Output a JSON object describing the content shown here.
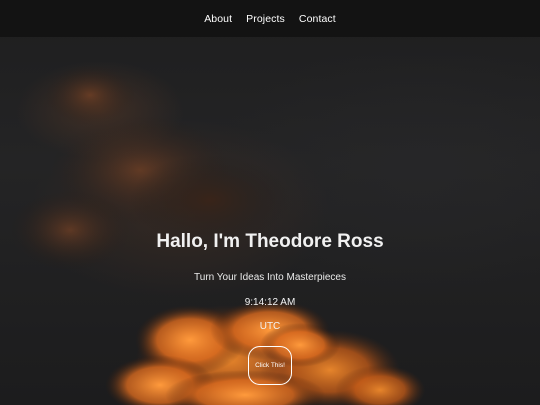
{
  "nav": {
    "items": [
      {
        "label": "About"
      },
      {
        "label": "Projects"
      },
      {
        "label": "Contact"
      }
    ]
  },
  "hero": {
    "title": "Hallo, I'm Theodore Ross",
    "subtitle": "Turn Your Ideas Into Masterpieces",
    "time": "9:14:12 AM",
    "timezone": "UTC",
    "button_label": "Click This!"
  },
  "colors": {
    "navbar_bg": "#131313",
    "sky_dark": "#1e1e1f",
    "cloud_orange": "#e8731f",
    "text": "#ffffff"
  }
}
